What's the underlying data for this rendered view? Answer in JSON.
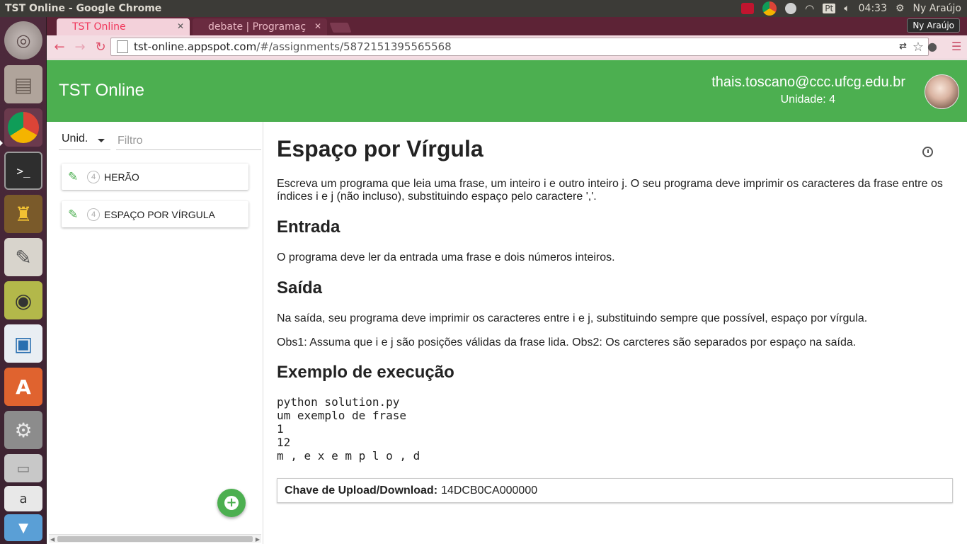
{
  "os_panel": {
    "window_title": "TST Online - Google Chrome",
    "clock": "04:33",
    "keyboard_layout": "Pt",
    "user_name": "Ny Araújo"
  },
  "browser": {
    "tabs": [
      {
        "title": "TST Online",
        "active": true
      },
      {
        "title": "debate | Programaç",
        "active": false
      }
    ],
    "profile_name": "Ny Araújo",
    "url_host": "tst-online.appspot.com",
    "url_path": "/#/assignments/5872151395565568"
  },
  "app": {
    "title": "TST Online",
    "user_email": "thais.toscano@ccc.ufcg.edu.br",
    "user_unit": "Unidade: 4",
    "accent_color": "#4caf50"
  },
  "sidebar": {
    "unit_select_value": "Unid.",
    "filter_placeholder": "Filtro",
    "assignments": [
      {
        "unit": "4",
        "label": "HERÃO"
      },
      {
        "unit": "4",
        "label": "ESPAÇO POR VÍRGULA"
      }
    ],
    "add_button": "+"
  },
  "assignment": {
    "title": "Espaço por Vírgula",
    "description": "Escreva um programa que leia uma frase, um inteiro i e outro inteiro j. O seu programa deve imprimir os caracteres da frase entre os índices i e j (não incluso), substituindo espaço pelo caractere ','.",
    "input_heading": "Entrada",
    "input_text": "O programa deve ler da entrada uma frase e dois números inteiros.",
    "output_heading": "Saída",
    "output_text": "Na saída, seu programa deve imprimir os caracteres entre i e j, substituindo sempre que possível, espaço por vírgula.",
    "obs_text": "Obs1: Assuma que i e j são posições válidas da frase lida. Obs2: Os carcteres são separados por espaço na saída.",
    "example_heading": "Exemplo de execução",
    "example_code": "python solution.py\num exemplo de frase\n1\n12\nm , e x e m p l o , d",
    "upload_label": "Chave de Upload/Download:",
    "upload_key": "14DCB0CA000000"
  }
}
